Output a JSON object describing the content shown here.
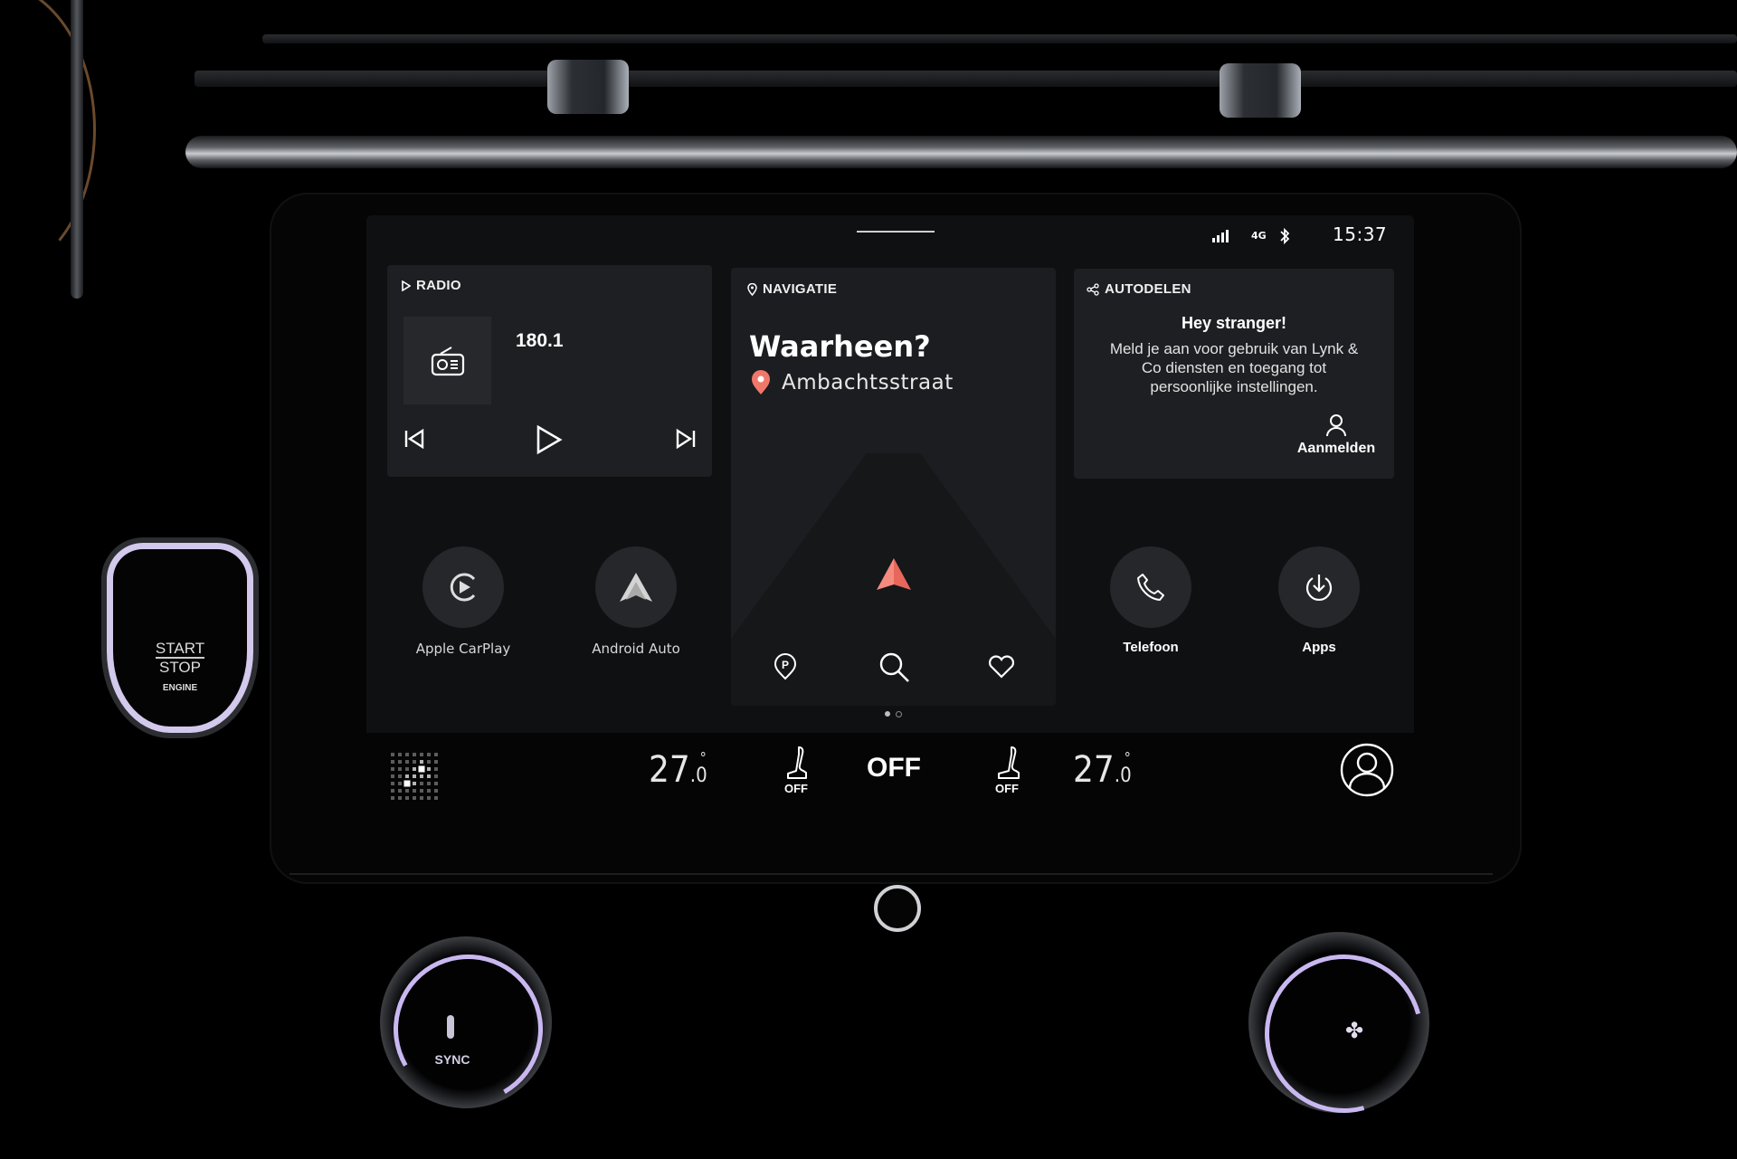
{
  "status_bar": {
    "signal_icon": "signal-bars-icon",
    "network": "4G",
    "bluetooth_icon": "bluetooth-icon",
    "time": "15:37"
  },
  "radio": {
    "label": "RADIO",
    "frequency": "180.1",
    "controls": [
      "previous",
      "play",
      "next"
    ]
  },
  "navigation": {
    "label": "NAVIGATIE",
    "title": "Waarheen?",
    "destination": "Ambachtsstraat",
    "accent": "#f0786a",
    "actions": [
      "parking",
      "search",
      "favorites"
    ],
    "page_count": 2,
    "active_page": 1
  },
  "autodelen": {
    "label": "AUTODELEN",
    "heading": "Hey stranger!",
    "body": "Meld je aan voor gebruik van Lynk & Co diensten en toegang tot persoonlijke instellingen.",
    "signin_label": "Aanmelden"
  },
  "apps": [
    {
      "label": "Apple CarPlay",
      "icon": "carplay-icon"
    },
    {
      "label": "Android Auto",
      "icon": "android-auto-icon"
    },
    {
      "label": "Telefoon",
      "icon": "phone-icon"
    },
    {
      "label": "Apps",
      "icon": "download-icon"
    }
  ],
  "climate": {
    "left_temp": "27",
    "left_temp_decimal": ".0",
    "left_seat": "OFF",
    "fan": "OFF",
    "right_seat": "OFF",
    "right_temp": "27",
    "right_temp_decimal": ".0",
    "degree_symbol": "°"
  },
  "hardware": {
    "start_stop_line1": "START",
    "start_stop_line2": "STOP",
    "start_stop_line3": "ENGINE",
    "left_knob_label": "SYNC",
    "ring_color": "#c9b8f0"
  }
}
